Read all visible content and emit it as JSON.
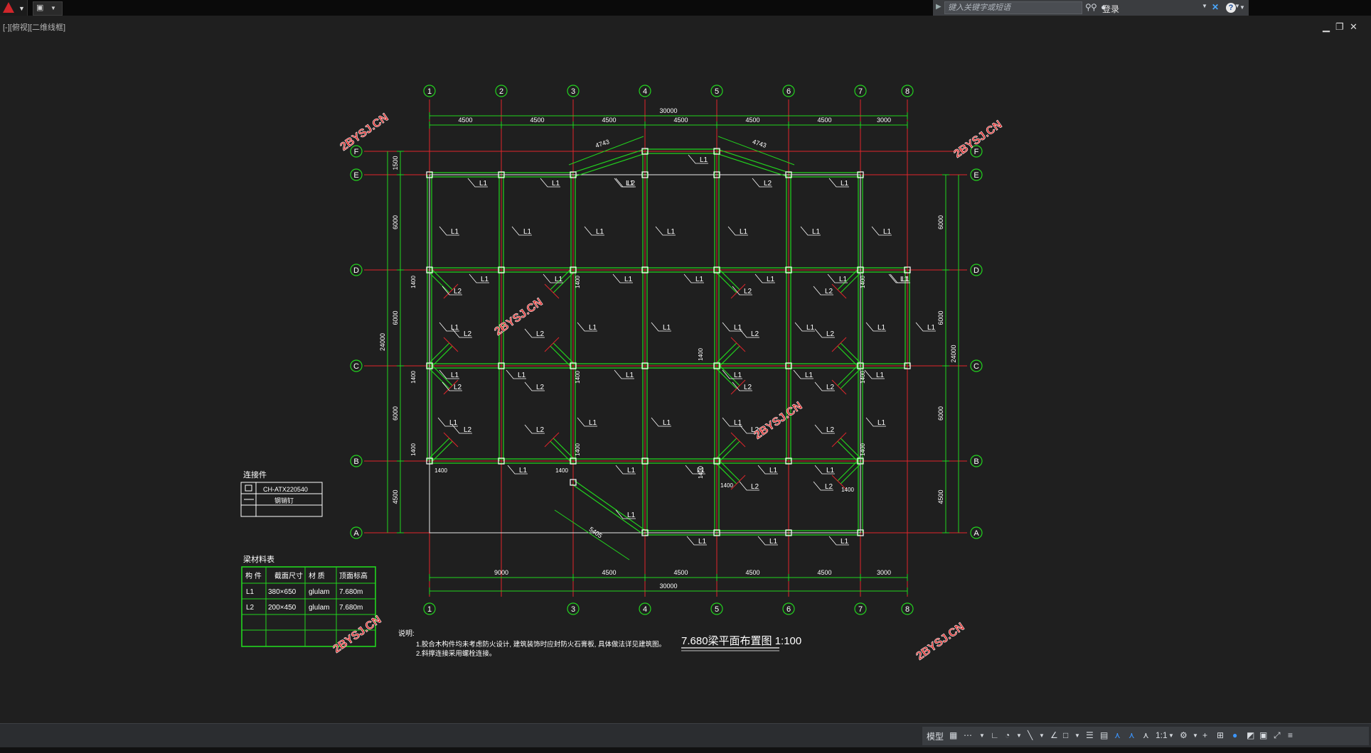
{
  "toolbar": {
    "search_placeholder": "键入关键字或短语",
    "login_label": "登录",
    "help_label": "?"
  },
  "viewport": {
    "label": "[-][俯视][二维线框]"
  },
  "drawing": {
    "title": "7.680梁平面布置图  1:100",
    "watermark": "2BYSJ.CN",
    "grid_columns": [
      "1",
      "2",
      "3",
      "4",
      "5",
      "6",
      "7",
      "8"
    ],
    "grid_rows": [
      "F",
      "E",
      "D",
      "C",
      "B",
      "A"
    ],
    "top_dims": [
      "4500",
      "4500",
      "4500",
      "4500",
      "4500",
      "4500",
      "3000"
    ],
    "top_total": "30000",
    "bottom_dims": [
      "9000",
      "4500",
      "4500",
      "4500",
      "4500",
      "3000"
    ],
    "bottom_total": "30000",
    "left_dims": [
      "1500",
      "6000",
      "6000",
      "6000",
      "4500"
    ],
    "left_total": "24000",
    "right_dims": [
      "6000",
      "6000",
      "6000",
      "4500"
    ],
    "right_total": "24000",
    "inclined_dims": [
      "4743",
      "4743",
      "5405"
    ],
    "local_dim_1400": "1400",
    "beam_L1": "L1",
    "beam_L2": "L2",
    "connector_legend": {
      "title": "连接件",
      "rows": [
        [
          "",
          "CH-ATX220540"
        ],
        [
          "",
          "钢销钉"
        ]
      ]
    },
    "material_table": {
      "title": "梁材料表",
      "headers": [
        "构 件",
        "截面尺寸",
        "材 质",
        "顶面标高"
      ],
      "rows": [
        [
          "L1",
          "380×650",
          "glulam",
          "7.680m"
        ],
        [
          "L2",
          "200×450",
          "glulam",
          "7.680m"
        ]
      ]
    },
    "notes": {
      "title": "说明:",
      "lines": [
        "1.胶合木构件均未考虑防火设计, 建筑装饰时应封防火石膏板, 具体做法详见建筑图。",
        "2.斜撑连接采用螺栓连接。"
      ]
    }
  },
  "statusbar": {
    "model_label": "模型",
    "scale_label": "1:1"
  },
  "colors": {
    "background": "#1f1f1f",
    "axis_red": "#e0262b",
    "beam_green": "#22d41e",
    "frame_white": "#ffffff",
    "watermark": "#e02a2a"
  }
}
